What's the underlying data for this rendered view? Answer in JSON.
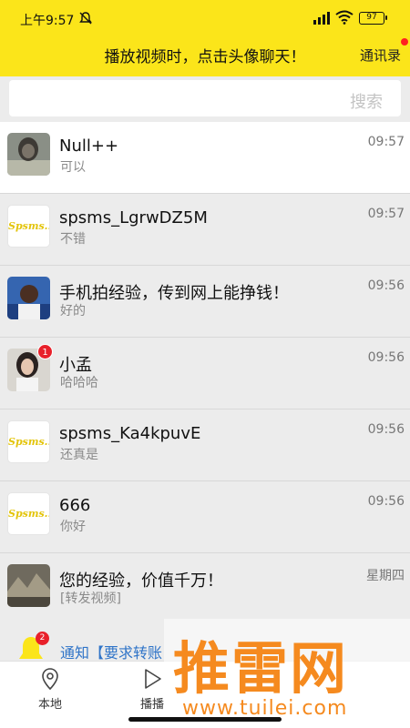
{
  "status_bar": {
    "time": "上午9:57",
    "battery": "97"
  },
  "header": {
    "title": "播放视频时，点击头像聊天！",
    "contacts_label": "通讯录"
  },
  "search": {
    "placeholder": "搜索"
  },
  "conversations": [
    {
      "name": "Null++",
      "preview": "可以",
      "time": "09:57",
      "avatar": "photo-avatar"
    },
    {
      "name": "spsms_LgrwDZ5M",
      "preview": "不错",
      "time": "09:57",
      "avatar": "spsms-logo",
      "logo_text": "Spsms..."
    },
    {
      "name": "手机拍经验，传到网上能挣钱！",
      "preview": "好的",
      "time": "09:56",
      "avatar": "photo-avatar"
    },
    {
      "name": "小孟",
      "preview": "哈哈哈",
      "time": "09:56",
      "avatar": "photo-avatar",
      "badge": "1"
    },
    {
      "name": "spsms_Ka4kpuvE",
      "preview": "还真是",
      "time": "09:56",
      "avatar": "spsms-logo",
      "logo_text": "Spsms..."
    },
    {
      "name": "666",
      "preview": "你好",
      "time": "09:56",
      "avatar": "spsms-logo",
      "logo_text": "Spsms..."
    },
    {
      "name": "您的经验，价值千万！",
      "preview": "[转发视频]",
      "time": "星期四",
      "avatar": "photo-avatar"
    }
  ],
  "notice": {
    "text": "通知【要求转账",
    "badge": "2"
  },
  "bottom_nav": [
    {
      "label": "本地",
      "icon": "location-pin-icon"
    },
    {
      "label": "播播",
      "icon": "play-icon"
    }
  ],
  "watermark": {
    "main": "推雷网",
    "url": "www.tuilei.com"
  },
  "colors": {
    "header_bg": "#fbe51a",
    "badge": "#e8202a",
    "notice_text": "#2f74c8",
    "watermark": "#f58a1f"
  }
}
